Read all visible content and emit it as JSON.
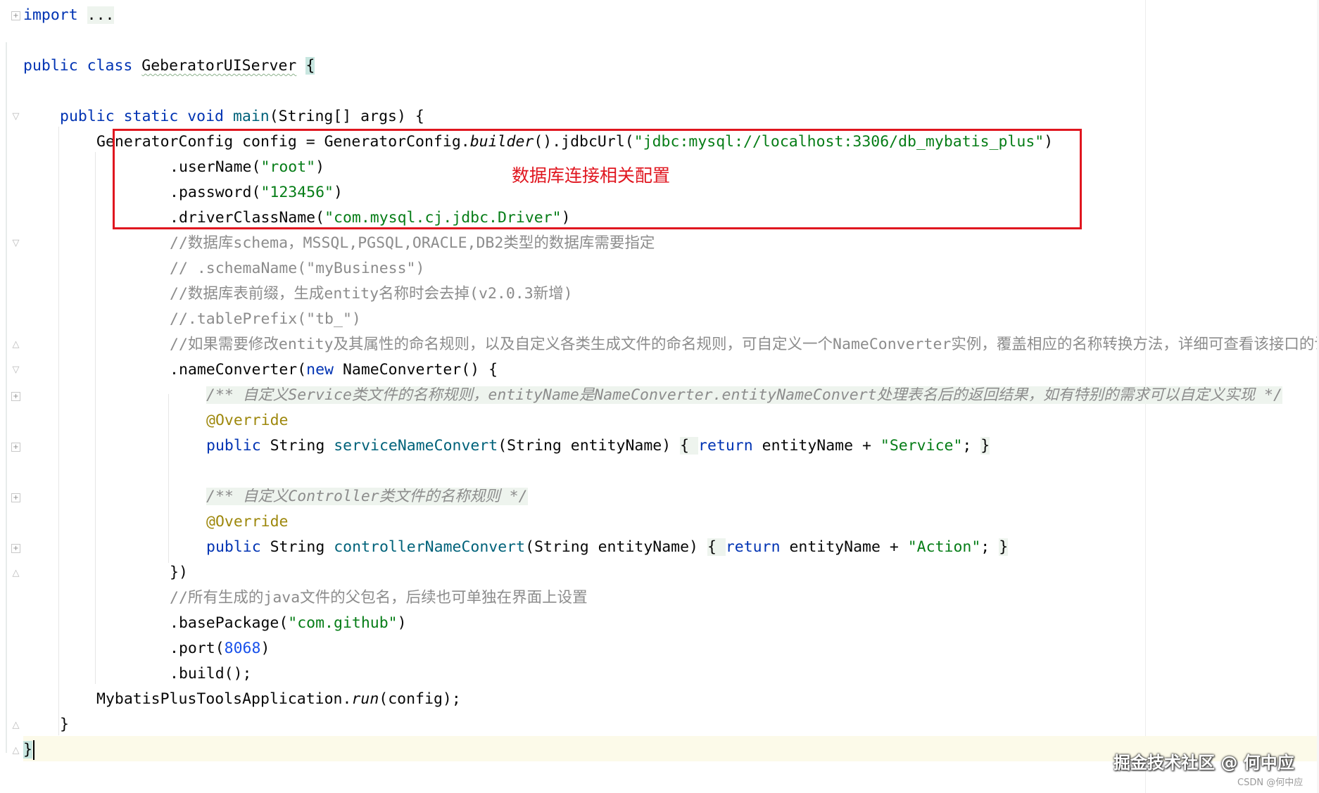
{
  "code": {
    "import_kw": "import",
    "import_fold": "...",
    "class_decl": {
      "kw": "public class",
      "name": "GeberatorUIServer",
      "brace": "{"
    },
    "main_decl": {
      "kw": "public static void",
      "name": "main",
      "params": "(String[] args) {"
    },
    "config_line": {
      "pre": "GeneratorConfig config = GeneratorConfig.",
      "builder": "builder",
      "mid": "().jdbcUrl(",
      "url": "\"jdbc:mysql://localhost:3306/db_mybatis_plus\"",
      "post": ")"
    },
    "username_line": {
      "pre": ".userName(",
      "val": "\"root\"",
      "post": ")"
    },
    "password_line": {
      "pre": ".password(",
      "val": "\"123456\"",
      "post": ")"
    },
    "driver_line": {
      "pre": ".driverClassName(",
      "val": "\"com.mysql.cj.jdbc.Driver\"",
      "post": ")"
    },
    "comment_schema": "//数据库schema，MSSQL,PGSQL,ORACLE,DB2类型的数据库需要指定",
    "comment_schemaname": "// .schemaName(\"myBusiness\")",
    "comment_prefix": "//数据库表前缀，生成entity名称时会去掉(v2.0.3新增)",
    "comment_tableprefix": "//.tablePrefix(\"tb_\")",
    "comment_converter": "//如果需要修改entity及其属性的命名规则，以及自定义各类生成文件的命名规则，可自定义一个NameConverter实例，覆盖相应的名称转换方法，详细可查看该接口的说明",
    "nameconverter_line": {
      "pre": ".nameConverter(",
      "kw": "new",
      "post": " NameConverter() {"
    },
    "doc_service": "/** 自定义Service类文件的名称规则，entityName是NameConverter.entityNameConvert处理表名后的返回结果，如有特别的需求可以自定义实现 */",
    "override": "@Override",
    "service_method": {
      "kw": "public",
      "type": " String ",
      "name": "serviceNameConvert",
      "params": "(String entityName) ",
      "open": "{ ",
      "ret": "return",
      "body": " entityName + ",
      "str": "\"Service\"",
      "end": "; ",
      "close": "}"
    },
    "doc_controller": "/** 自定义Controller类文件的名称规则 */",
    "controller_method": {
      "kw": "public",
      "type": " String ",
      "name": "controllerNameConvert",
      "params": "(String entityName) ",
      "open": "{ ",
      "ret": "return",
      "body": " entityName + ",
      "str": "\"Action\"",
      "end": "; ",
      "close": "}"
    },
    "close_anon": "})",
    "comment_package": "//所有生成的java文件的父包名，后续也可单独在界面上设置",
    "basepackage_line": {
      "pre": ".basePackage(",
      "val": "\"com.github\"",
      "post": ")"
    },
    "port_line": {
      "pre": ".port(",
      "val": "8068",
      "post": ")"
    },
    "build_line": ".build();",
    "run_line": {
      "pre": "MybatisPlusToolsApplication.",
      "run": "run",
      "post": "(config);"
    },
    "close_main": "}",
    "close_class": "}"
  },
  "annotation_text": "数据库连接相关配置",
  "watermark": "掘金技术社区 @ 何中应",
  "watermark_sub": "CSDN @何中应",
  "colors": {
    "keyword": "#0033b3",
    "string": "#067d17",
    "number": "#1750eb",
    "method": "#00627a",
    "comment": "#8c8c8c",
    "annotation": "#9e880d",
    "highlight_box": "#e0161f"
  },
  "icons": [
    "fold-expand-icon",
    "fold-collapse-icon"
  ]
}
